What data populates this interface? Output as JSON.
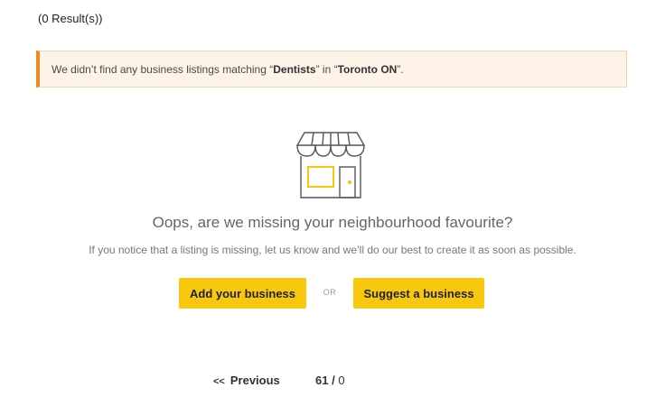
{
  "results": {
    "count_text": "(0 Result(s))"
  },
  "alert": {
    "prefix": "We didn’t find any business listings matching “",
    "term": "Dentists",
    "middle": "” in “",
    "location": "Toronto ON",
    "suffix": "”."
  },
  "empty_state": {
    "icon": "storefront-icon",
    "headline": "Oops, are we missing your neighbourhood favourite?",
    "subtext": "If you notice that a listing is missing, let us know and we’ll do our best to create it as soon as possible."
  },
  "actions": {
    "add_label": "Add your business",
    "or_label": "OR",
    "suggest_label": "Suggest a business"
  },
  "pagination": {
    "prev_arrows": "<<",
    "prev_label": "Previous",
    "current": "61",
    "separator": "/",
    "total": "0"
  },
  "colors": {
    "accent_yellow": "#f8c811",
    "alert_border": "#f0891f",
    "alert_bg": "#fdf3e8",
    "icon_stroke": "#555555"
  }
}
